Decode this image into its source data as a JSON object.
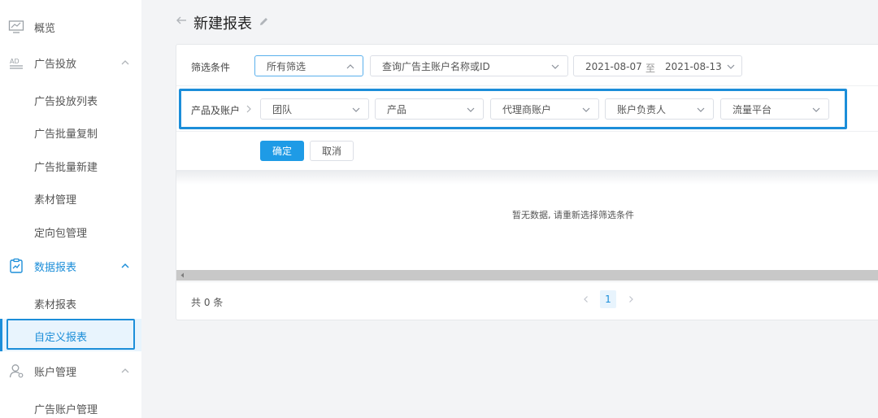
{
  "sidebar": {
    "overview": "概览",
    "ad_delivery": "广告投放",
    "ad_delivery_items": [
      "广告投放列表",
      "广告批量复制",
      "广告批量新建",
      "素材管理",
      "定向包管理"
    ],
    "data_report": "数据报表",
    "data_report_items": [
      "素材报表",
      "自定义报表"
    ],
    "account_mgmt": "账户管理",
    "account_items": [
      "广告账户管理"
    ]
  },
  "header": {
    "title": "新建报表"
  },
  "filter": {
    "label": "筛选条件",
    "scope_select": "所有筛选",
    "search_select": "查询广告主账户名称或ID",
    "date_start": "2021-08-07",
    "date_sep": "至",
    "date_end": "2021-08-13"
  },
  "dimension": {
    "label": "产品及账户",
    "selects": [
      "团队",
      "产品",
      "代理商账户",
      "账户负责人",
      "流量平台"
    ]
  },
  "actions": {
    "confirm": "确定",
    "cancel": "取消"
  },
  "table": {
    "empty": "暂无数据, 请重新选择筛选条件"
  },
  "pagination": {
    "total": "共 0 条",
    "current_page": "1"
  },
  "colors": {
    "accent": "#1c8ed9",
    "primary_button": "#1e9be6"
  }
}
